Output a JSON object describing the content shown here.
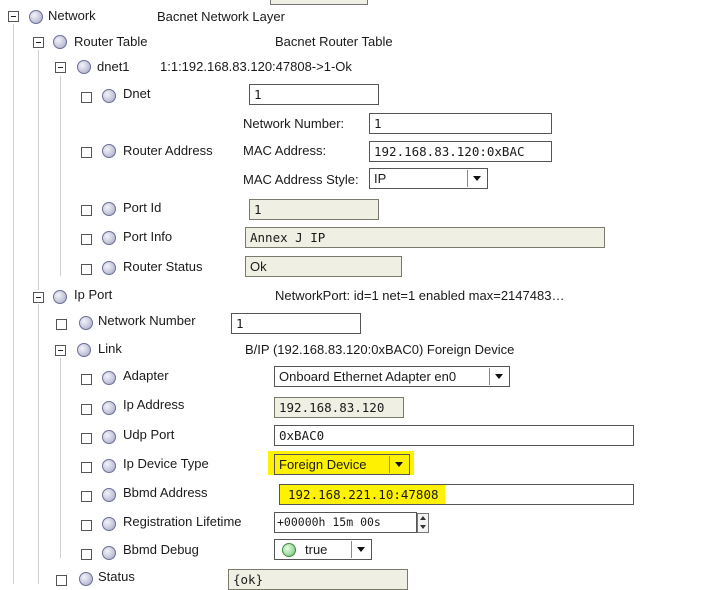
{
  "tree": {
    "network": {
      "label": "Network",
      "desc": "Bacnet Network Layer"
    },
    "router_table": {
      "label": "Router Table",
      "desc": "Bacnet Router Table"
    },
    "dnet1": {
      "label": "dnet1",
      "desc": "1:1:192.168.83.120:47808->1-Ok"
    },
    "dnet": {
      "label": "Dnet",
      "value": "1"
    },
    "router_address": {
      "label": "Router Address",
      "network_number_label": "Network Number:",
      "network_number": "1",
      "mac_address_label": "MAC Address:",
      "mac_address": "192.168.83.120:0xBAC",
      "mac_style_label": "MAC Address Style:",
      "mac_style": "IP"
    },
    "port_id": {
      "label": "Port Id",
      "value": "1"
    },
    "port_info": {
      "label": "Port Info",
      "value": "Annex J IP"
    },
    "router_status": {
      "label": "Router Status",
      "value": "Ok"
    },
    "ip_port": {
      "label": "Ip Port",
      "desc": "NetworkPort: id=1 net=1 enabled max=2147483…"
    },
    "network_number": {
      "label": "Network Number",
      "value": "1"
    },
    "link": {
      "label": "Link",
      "desc": "B/IP (192.168.83.120:0xBAC0) Foreign Device"
    },
    "adapter": {
      "label": "Adapter",
      "value": "Onboard Ethernet Adapter en0"
    },
    "ip_address": {
      "label": "Ip Address",
      "value": "192.168.83.120"
    },
    "udp_port": {
      "label": "Udp Port",
      "value": "0xBAC0"
    },
    "ip_device_type": {
      "label": "Ip Device Type",
      "value": "Foreign Device"
    },
    "bbmd_address": {
      "label": "Bbmd Address",
      "value": "192.168.221.10:47808"
    },
    "registration_lifetime": {
      "label": "Registration Lifetime",
      "value": "+00000h 15m 00s"
    },
    "bbmd_debug": {
      "label": "Bbmd Debug",
      "value": "true"
    },
    "status": {
      "label": "Status",
      "value": "{ok}"
    }
  },
  "colors": {
    "highlight": "#fff200",
    "readonly_bg": "#efefe3"
  }
}
